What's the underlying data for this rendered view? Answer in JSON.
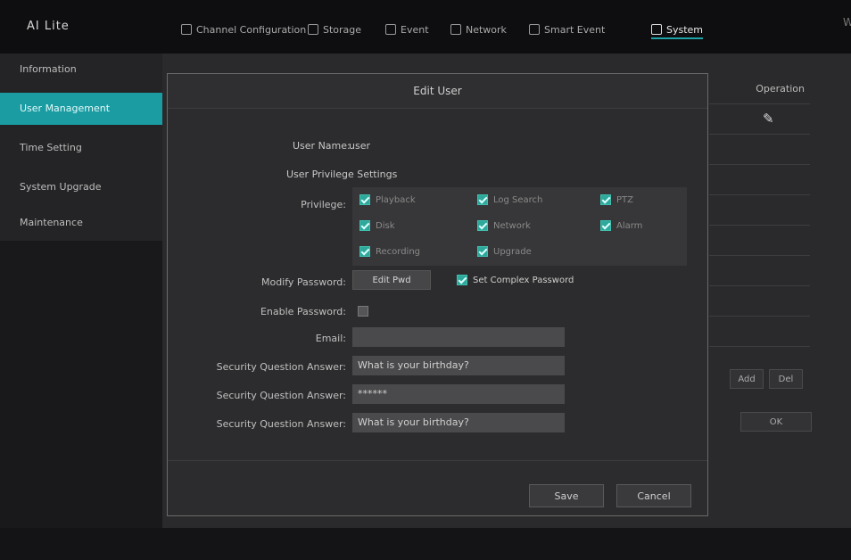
{
  "topbar": {
    "logo": "AI Lite",
    "nav": [
      {
        "label": "Channel Configuration"
      },
      {
        "label": "Storage"
      },
      {
        "label": "Event"
      },
      {
        "label": "Network"
      },
      {
        "label": "Smart Event"
      },
      {
        "label": "System"
      }
    ],
    "right": "W"
  },
  "sidebar": {
    "items": [
      {
        "label": "Information"
      },
      {
        "label": "User Management"
      },
      {
        "label": "Time Setting"
      },
      {
        "label": "System Upgrade"
      },
      {
        "label": "Maintenance"
      }
    ]
  },
  "background": {
    "column_header": "Operation",
    "row_icon": "✎",
    "buttons": [
      "Add",
      "Del",
      "OK"
    ]
  },
  "dialog": {
    "title": "Edit User",
    "username_label": "User Name:",
    "username_value": "user",
    "privilege_text": "User Privilege Settings",
    "privilege_label": "Privilege:",
    "categories": [
      {
        "label": "Playback",
        "checked": true
      },
      {
        "label": "Log Search",
        "checked": true
      },
      {
        "label": "PTZ",
        "checked": true
      },
      {
        "label": "Disk",
        "checked": true
      },
      {
        "label": "Network",
        "checked": true
      },
      {
        "label": "Alarm",
        "checked": true
      },
      {
        "label": "Recording",
        "checked": true
      },
      {
        "label": "Upgrade",
        "checked": true
      }
    ],
    "modify_password_label": "Modify Password:",
    "modify_password_button": "Edit Pwd",
    "complex_label": "Set Complex Password",
    "enable_password_label": "Enable Password:",
    "email_label": "Email:",
    "email_value": "",
    "q1_label": "Security Question Answer:",
    "q1_value": "What is your birthday?",
    "a1_label": "Security Question Answer:",
    "a1_value": "******",
    "q2_label": "Security Question Answer:",
    "q2_value": "What is your birthday?",
    "save": "Save",
    "cancel": "Cancel"
  }
}
